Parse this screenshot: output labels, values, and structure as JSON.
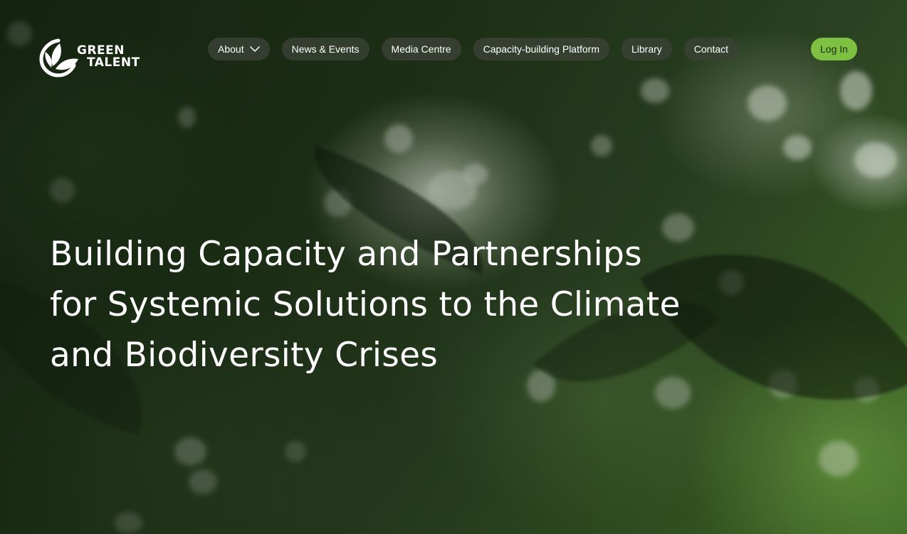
{
  "brand": {
    "line1": "GREEN",
    "line2": "TALENT"
  },
  "nav": {
    "items": [
      {
        "label": "About",
        "has_dropdown": true,
        "icon": "chevron-down-icon"
      },
      {
        "label": "News & Events"
      },
      {
        "label": "Media Centre"
      },
      {
        "label": "Capacity-building Platform"
      },
      {
        "label": "Library"
      },
      {
        "label": "Contact"
      }
    ],
    "login_label": "Log In"
  },
  "hero": {
    "headline_lines": [
      "Building Capacity and Partnerships",
      "for Systemic Solutions to the Climate",
      "and Biodiversity Crises"
    ]
  },
  "colors": {
    "accent": "#7ec142",
    "nav_pill_bg": "#3a4236",
    "text": "#ffffff"
  }
}
